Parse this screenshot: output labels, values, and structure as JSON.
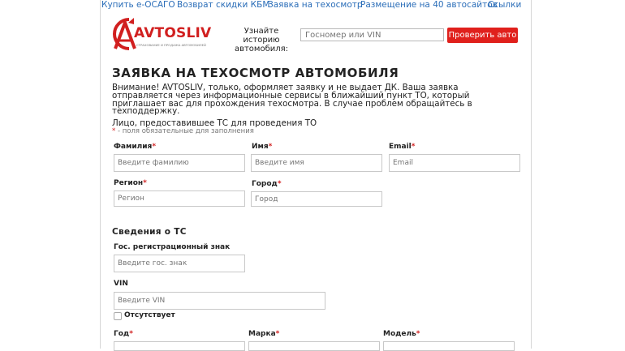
{
  "topnav": [
    {
      "label": "Купить е-ОСАГО"
    },
    {
      "label": "Возврат скидки КБМ"
    },
    {
      "label": "Заявка на техосмотр"
    },
    {
      "label": "Размещение на 40 автосайтов"
    },
    {
      "label": "Ссылки"
    }
  ],
  "brand": {
    "name": "AVTOSLIV",
    "tagline": "СТРАХОВАНИЕ И ПРОДАЖА АВТОМОБИЛЕЙ",
    "color": "#d11f1f"
  },
  "history": {
    "label": "Узнайте историю автомобиля:",
    "placeholder": "Госномер или VIN",
    "button": "Проверить авто"
  },
  "page": {
    "title": "ЗАЯВКА НА ТЕХОСМОТР АВТОМОБИЛЯ",
    "notice": "Внимание! AVTOSLIV, только, оформляет заявку и не выдает ДК. Ваша заявка отправляется через информационные сервисы в ближайший пункт ТО, который приглашает вас для прохождения техосмотра. В случае проблем обращайтесь в техподдержку."
  },
  "person": {
    "section_label": "Лицо, предоставившее ТС для проведения ТО",
    "required_star": "*",
    "required_note": " - поля обязательные для заполнения",
    "lastname": {
      "label": "Фамилия",
      "placeholder": "Введите фамилию"
    },
    "firstname": {
      "label": "Имя",
      "placeholder": "Введите имя"
    },
    "email": {
      "label": "Email",
      "placeholder": "Email"
    },
    "region": {
      "label": "Регион",
      "placeholder": "Регион"
    },
    "city": {
      "label": "Город",
      "placeholder": "Город"
    }
  },
  "vehicle": {
    "heading": "Сведения о ТС",
    "plate": {
      "label": "Гос. регистрационный знак",
      "placeholder": "Введите гос. знак"
    },
    "vin": {
      "label": "VIN",
      "placeholder": "Введите VIN"
    },
    "absent_label": "Отсутствует",
    "year": {
      "label": "Год"
    },
    "make": {
      "label": "Марка"
    },
    "model": {
      "label": "Модель"
    }
  },
  "star": "*",
  "accent_color": "#e0201c",
  "link_color": "#2a6db8"
}
